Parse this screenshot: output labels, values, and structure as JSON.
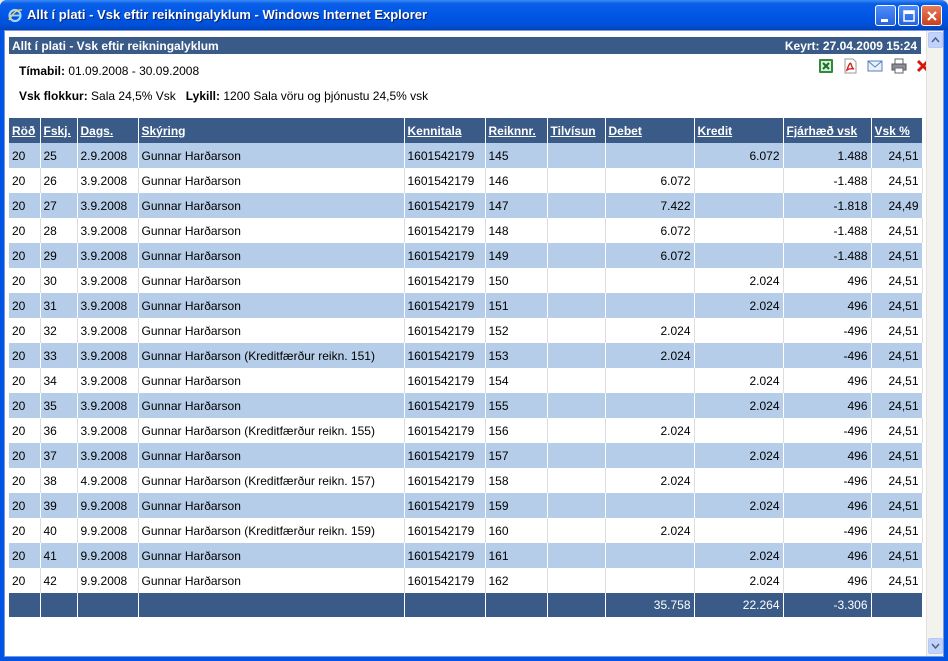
{
  "window": {
    "title": "Allt í plati - Vsk eftir reikningalyklum - Windows Internet Explorer"
  },
  "report": {
    "header_title": "Allt í plati - Vsk eftir reikningalyklum",
    "run_label": "Keyrt:",
    "run_value": "27.04.2009 15:24",
    "period_label": "Tímabil:",
    "period_value": "01.09.2008 - 30.09.2008",
    "vat_group_label": "Vsk flokkur:",
    "vat_group_value": "Sala 24,5% Vsk",
    "account_label": "Lykill:",
    "account_value": "1200 Sala vöru og þjónustu 24,5% vsk"
  },
  "toolbar_icons": [
    "excel-icon",
    "pdf-icon",
    "email-icon",
    "print-icon",
    "close-icon"
  ],
  "table": {
    "columns": [
      "Röð",
      "Fskj.",
      "Dags.",
      "Skýring",
      "Kennitala",
      "Reiknnr.",
      "Tilvísun",
      "Debet",
      "Kredit",
      "Fjárhæð vsk",
      "Vsk %"
    ],
    "rows": [
      [
        "20",
        "25",
        "2.9.2008",
        "Gunnar Harðarson",
        "1601542179",
        "145",
        "",
        "",
        "6.072",
        "1.488",
        "24,51"
      ],
      [
        "20",
        "26",
        "3.9.2008",
        "Gunnar Harðarson",
        "1601542179",
        "146",
        "",
        "6.072",
        "",
        "-1.488",
        "24,51"
      ],
      [
        "20",
        "27",
        "3.9.2008",
        "Gunnar Harðarson",
        "1601542179",
        "147",
        "",
        "7.422",
        "",
        "-1.818",
        "24,49"
      ],
      [
        "20",
        "28",
        "3.9.2008",
        "Gunnar Harðarson",
        "1601542179",
        "148",
        "",
        "6.072",
        "",
        "-1.488",
        "24,51"
      ],
      [
        "20",
        "29",
        "3.9.2008",
        "Gunnar Harðarson",
        "1601542179",
        "149",
        "",
        "6.072",
        "",
        "-1.488",
        "24,51"
      ],
      [
        "20",
        "30",
        "3.9.2008",
        "Gunnar Harðarson",
        "1601542179",
        "150",
        "",
        "",
        "2.024",
        "496",
        "24,51"
      ],
      [
        "20",
        "31",
        "3.9.2008",
        "Gunnar Harðarson",
        "1601542179",
        "151",
        "",
        "",
        "2.024",
        "496",
        "24,51"
      ],
      [
        "20",
        "32",
        "3.9.2008",
        "Gunnar Harðarson",
        "1601542179",
        "152",
        "",
        "2.024",
        "",
        "-496",
        "24,51"
      ],
      [
        "20",
        "33",
        "3.9.2008",
        "Gunnar Harðarson (Kreditfærður reikn. 151)",
        "1601542179",
        "153",
        "",
        "2.024",
        "",
        "-496",
        "24,51"
      ],
      [
        "20",
        "34",
        "3.9.2008",
        "Gunnar Harðarson",
        "1601542179",
        "154",
        "",
        "",
        "2.024",
        "496",
        "24,51"
      ],
      [
        "20",
        "35",
        "3.9.2008",
        "Gunnar Harðarson",
        "1601542179",
        "155",
        "",
        "",
        "2.024",
        "496",
        "24,51"
      ],
      [
        "20",
        "36",
        "3.9.2008",
        "Gunnar Harðarson (Kreditfærður reikn. 155)",
        "1601542179",
        "156",
        "",
        "2.024",
        "",
        "-496",
        "24,51"
      ],
      [
        "20",
        "37",
        "3.9.2008",
        "Gunnar Harðarson",
        "1601542179",
        "157",
        "",
        "",
        "2.024",
        "496",
        "24,51"
      ],
      [
        "20",
        "38",
        "4.9.2008",
        "Gunnar Harðarson (Kreditfærður reikn. 157)",
        "1601542179",
        "158",
        "",
        "2.024",
        "",
        "-496",
        "24,51"
      ],
      [
        "20",
        "39",
        "9.9.2008",
        "Gunnar Harðarson",
        "1601542179",
        "159",
        "",
        "",
        "2.024",
        "496",
        "24,51"
      ],
      [
        "20",
        "40",
        "9.9.2008",
        "Gunnar Harðarson (Kreditfærður reikn. 159)",
        "1601542179",
        "160",
        "",
        "2.024",
        "",
        "-496",
        "24,51"
      ],
      [
        "20",
        "41",
        "9.9.2008",
        "Gunnar Harðarson",
        "1601542179",
        "161",
        "",
        "",
        "2.024",
        "496",
        "24,51"
      ],
      [
        "20",
        "42",
        "9.9.2008",
        "Gunnar Harðarson",
        "1601542179",
        "162",
        "",
        "",
        "2.024",
        "496",
        "24,51"
      ]
    ],
    "totals": [
      "",
      "",
      "",
      "",
      "",
      "",
      "",
      "35.758",
      "22.264",
      "-3.306",
      ""
    ]
  },
  "colors": {
    "header_bg": "#3a5b87",
    "alt_row_bg": "#b5cde8",
    "titlebar": "#0054e3"
  }
}
